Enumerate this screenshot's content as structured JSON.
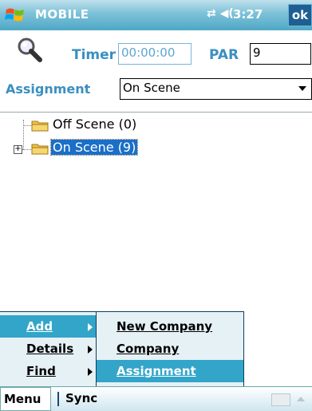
{
  "titlebar": {
    "title": "MOBILE",
    "time": "3:27",
    "ok_label": "ok"
  },
  "form": {
    "timer_label": "Timer",
    "timer_value": "00:00:00",
    "par_label": "PAR",
    "par_value": "9",
    "assignment_label": "Assignment",
    "assignment_value": "On Scene"
  },
  "tree": {
    "nodes": [
      {
        "label": "Off Scene (0)",
        "expandable": false,
        "selected": false
      },
      {
        "label": "On Scene (9)",
        "expandable": true,
        "selected": true
      }
    ]
  },
  "menu": {
    "items": [
      {
        "label": "Add",
        "has_submenu": true,
        "highlighted": true
      },
      {
        "label": "Details",
        "has_submenu": true,
        "highlighted": false
      },
      {
        "label": "Find",
        "has_submenu": true,
        "highlighted": false
      }
    ],
    "submenu": [
      {
        "label": "New Company",
        "highlighted": false
      },
      {
        "label": "Company",
        "highlighted": false
      },
      {
        "label": "Assignment",
        "highlighted": true
      }
    ]
  },
  "bottombar": {
    "left_label": "Menu",
    "right_label": "Sync"
  },
  "colors": {
    "accent": "#3a8fc0",
    "highlight": "#32a5c9",
    "selection": "#1a6fc7"
  },
  "icons": {
    "start": "windows-logo-icon",
    "connectivity": "connectivity-icon",
    "volume": "volume-icon",
    "search": "search-icon",
    "folder": "folder-icon",
    "keyboard": "keyboard-icon"
  }
}
